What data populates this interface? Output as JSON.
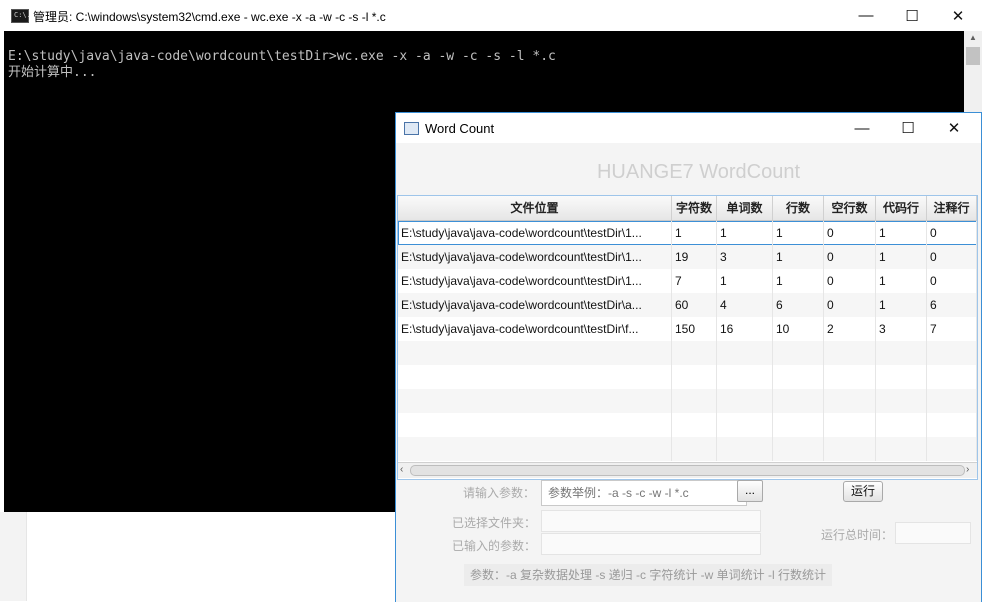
{
  "cmd": {
    "title": "管理员: C:\\windows\\system32\\cmd.exe - wc.exe  -x -a -w -c -s -l *.c",
    "lines": [
      "E:\\study\\java\\java-code\\wordcount\\testDir>wc.exe -x -a -w -c -s -l *.c",
      "开始计算中..."
    ],
    "icon_label": "C:\\."
  },
  "window_controls": {
    "minimize": "—",
    "maximize": "☐",
    "close": "✕"
  },
  "wordcount": {
    "title": "Word Count",
    "heading": "HUANGE7 WordCount",
    "columns": [
      "文件位置",
      "字符数",
      "单词数",
      "行数",
      "空行数",
      "代码行",
      "注释行"
    ],
    "rows": [
      [
        "E:\\study\\java\\java-code\\wordcount\\testDir\\1...",
        "1",
        "1",
        "1",
        "0",
        "1",
        "0"
      ],
      [
        "E:\\study\\java\\java-code\\wordcount\\testDir\\1...",
        "19",
        "3",
        "1",
        "0",
        "1",
        "0"
      ],
      [
        "E:\\study\\java\\java-code\\wordcount\\testDir\\1...",
        "7",
        "1",
        "1",
        "0",
        "1",
        "0"
      ],
      [
        "E:\\study\\java\\java-code\\wordcount\\testDir\\a...",
        "60",
        "4",
        "6",
        "0",
        "1",
        "6"
      ],
      [
        "E:\\study\\java\\java-code\\wordcount\\testDir\\f...",
        "150",
        "16",
        "10",
        "2",
        "3",
        "7"
      ]
    ],
    "scroll_left": "‹",
    "scroll_right": "›",
    "param_label": "请输入参数：",
    "param_placeholder": "参数举例：-a -s -c -w -l *.c",
    "browse_label": "...",
    "run_label": "运行",
    "folder_label": "已选择文件夹：",
    "entered_label": "已输入的参数：",
    "time_label": "运行总时间：",
    "hint": "参数：-a 复杂数据处理   -s 递归   -c 字符统计   -w  单词统计   -l 行数统计"
  }
}
